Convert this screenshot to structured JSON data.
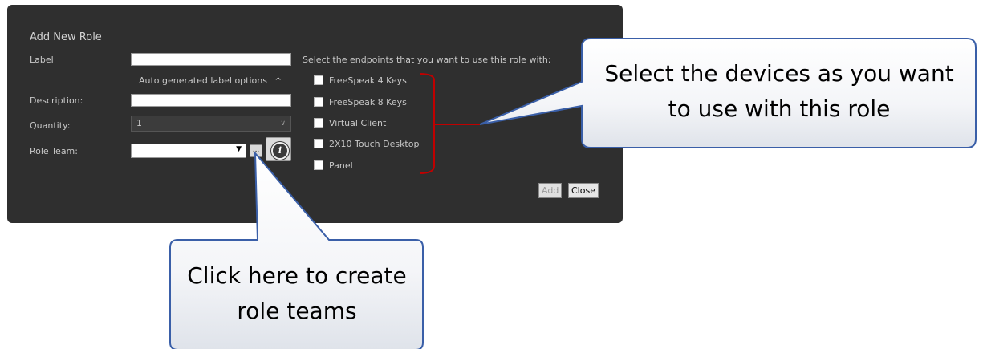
{
  "dialog": {
    "title": "Add New Role",
    "label_label": "Label",
    "auto_generated": "Auto generated label options",
    "auto_generated_caret": "^",
    "description_label": "Description:",
    "quantity_label": "Quantity:",
    "quantity_value": "1",
    "role_team_label": "Role Team:",
    "ellipsis_button": "...",
    "info_icon": "i",
    "endpoints_label": "Select the endpoints that you want to use this role with:",
    "endpoints": [
      {
        "label": "FreeSpeak 4 Keys"
      },
      {
        "label": "FreeSpeak 8 Keys"
      },
      {
        "label": "Virtual Client"
      },
      {
        "label": "2X10 Touch Desktop"
      },
      {
        "label": "Panel"
      }
    ],
    "add_button": "Add",
    "close_button": "Close"
  },
  "callouts": {
    "devices": {
      "line1": "Select the devices as you want",
      "line2": "to use with this role"
    },
    "teams": {
      "line1": "Click here to create",
      "line2": "role teams"
    }
  },
  "colors": {
    "dialog_bg": "#2f2f2f",
    "callout_border": "#3a5fa8",
    "bracket": "#c00000"
  }
}
